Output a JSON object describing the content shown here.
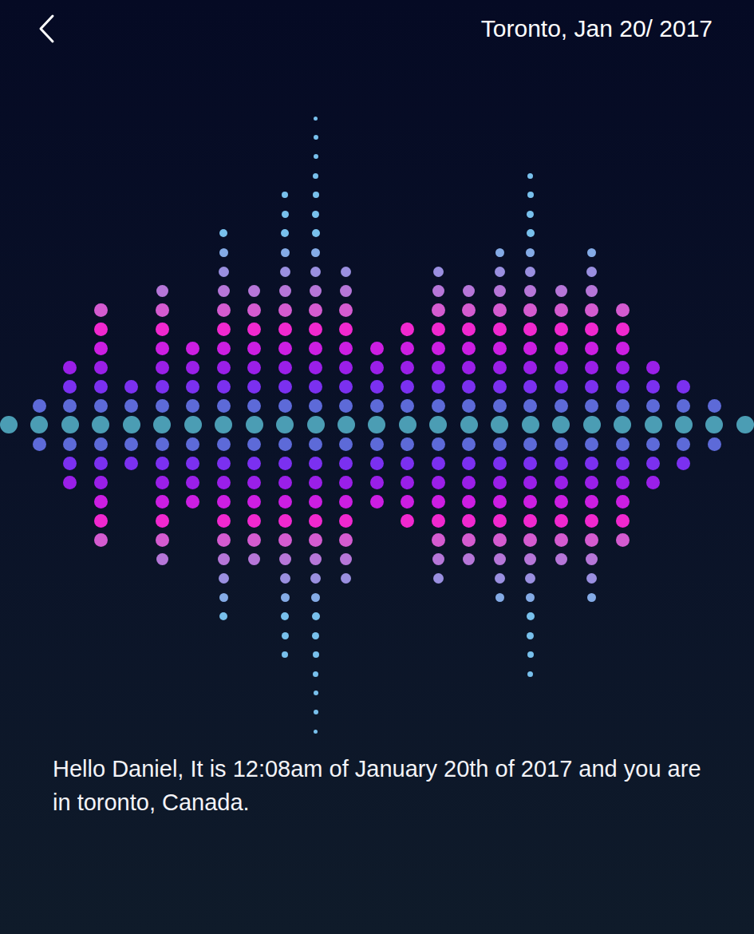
{
  "header": {
    "title": "Toronto, Jan 20/ 2017"
  },
  "waveform": {
    "values": [
      0,
      1,
      3,
      6,
      2,
      7,
      4,
      10,
      7,
      12,
      16,
      8,
      4,
      5,
      8,
      7,
      9,
      13,
      7,
      9,
      6,
      3,
      2,
      1,
      0
    ]
  },
  "message": "Hello Daniel, It is 12:08am of January 20th of 2017 and you are in toronto, Canada."
}
